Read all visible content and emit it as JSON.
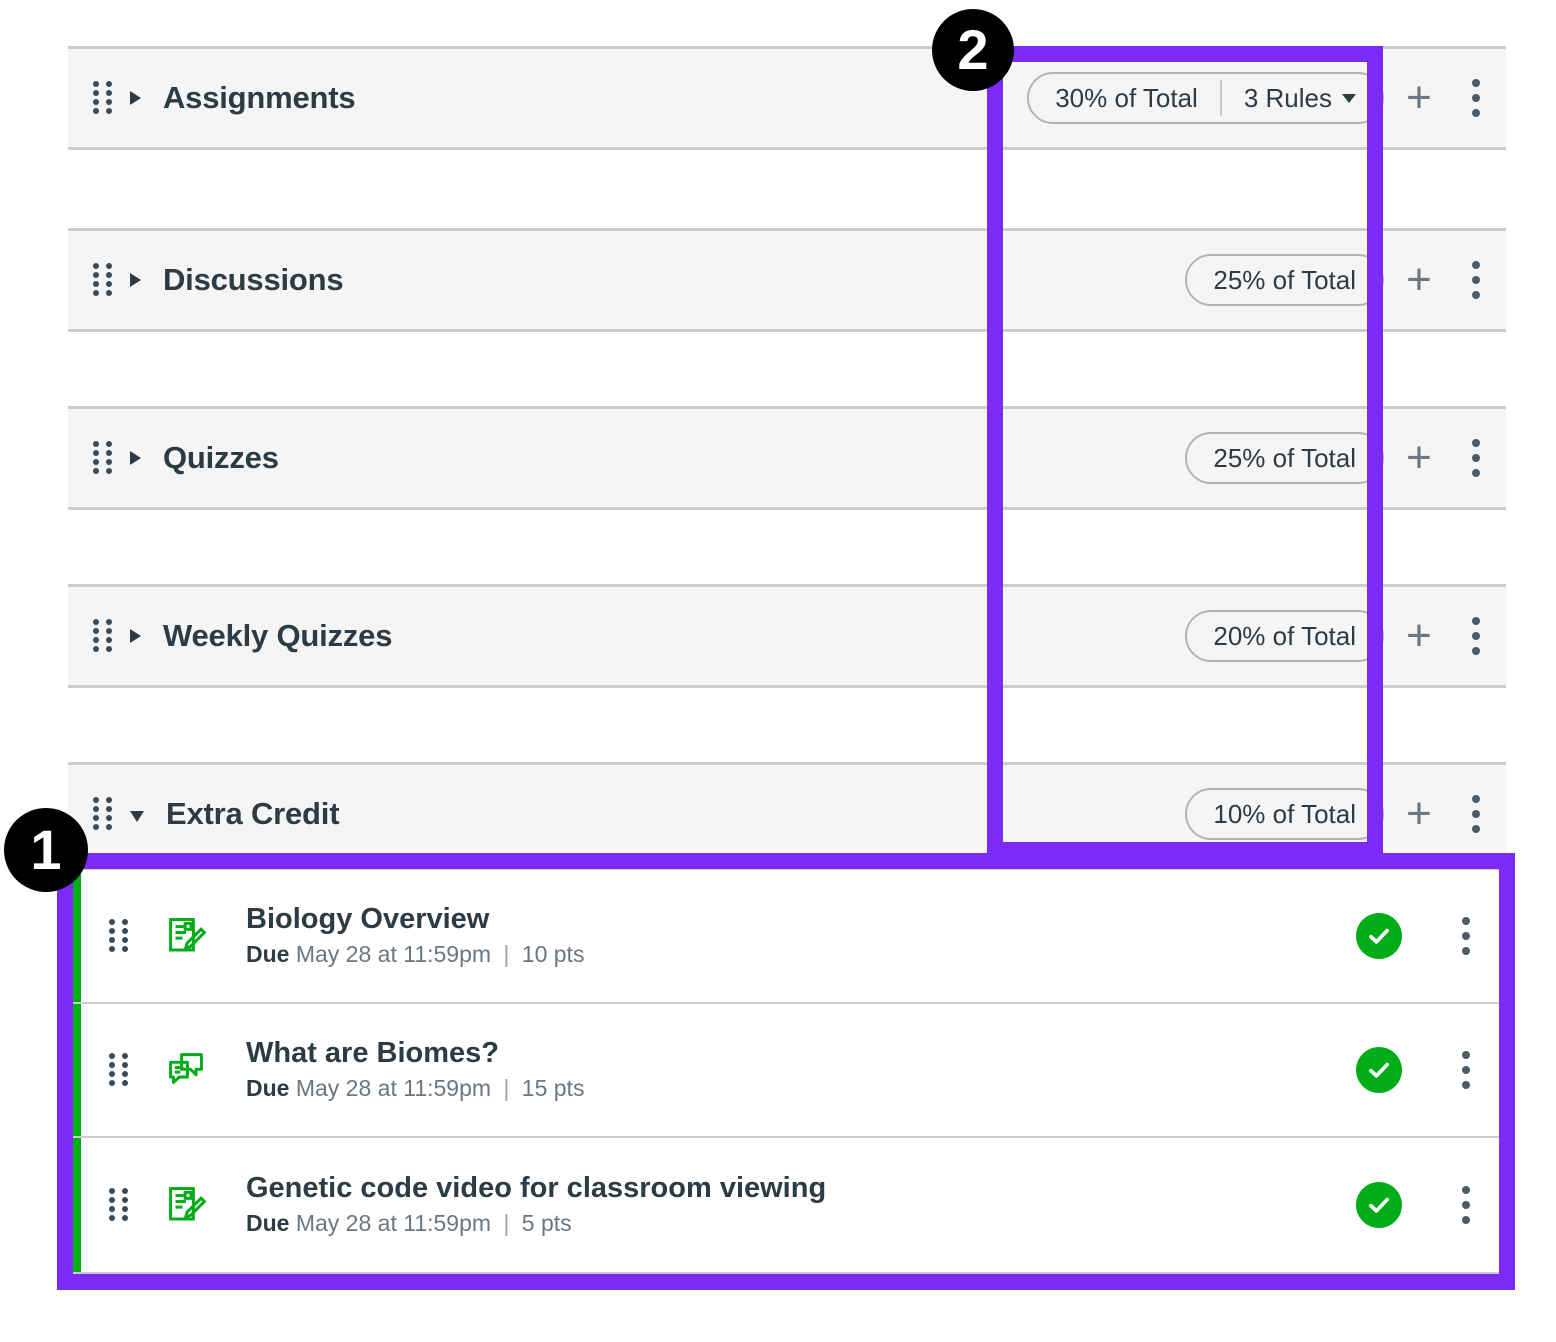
{
  "groups": [
    {
      "name": "Assignments",
      "expanded": false,
      "weight": "30% of Total",
      "rules": "3 Rules",
      "has_rules": true
    },
    {
      "name": "Discussions",
      "expanded": false,
      "weight": "25% of Total",
      "rules": "",
      "has_rules": false
    },
    {
      "name": "Quizzes",
      "expanded": false,
      "weight": "25% of Total",
      "rules": "",
      "has_rules": false
    },
    {
      "name": "Weekly Quizzes",
      "expanded": false,
      "weight": "20% of Total",
      "rules": "",
      "has_rules": false
    },
    {
      "name": "Extra Credit",
      "expanded": true,
      "weight": "10% of Total",
      "rules": "",
      "has_rules": false
    }
  ],
  "items": [
    {
      "title": "Biology Overview",
      "due_label": "Due",
      "due_date": "May 28 at 11:59pm",
      "separator": "|",
      "points": "10 pts",
      "icon": "assignment-icon",
      "status": "published"
    },
    {
      "title": "What are Biomes?",
      "due_label": "Due",
      "due_date": "May 28 at 11:59pm",
      "separator": "|",
      "points": "15 pts",
      "icon": "discussion-icon",
      "status": "published"
    },
    {
      "title": "Genetic code video for classroom viewing",
      "due_label": "Due",
      "due_date": "May 28 at 11:59pm",
      "separator": "|",
      "points": "5 pts",
      "icon": "assignment-icon",
      "status": "published"
    }
  ],
  "annotations": [
    {
      "label": "1"
    },
    {
      "label": "2"
    }
  ],
  "colors": {
    "annotation_purple": "#7C2BF7",
    "published_green": "#00AC18",
    "group_header_bg": "#F5F5F5",
    "border_gray": "#C7CDD1",
    "text_dark": "#2D3B45",
    "text_muted": "#6B7780"
  },
  "icons": {
    "drag_handle": "drag-handle-icon",
    "collapse_arrow": "triangle-right-icon",
    "expand_arrow": "triangle-down-icon",
    "add": "plus-icon",
    "more": "kebab-menu-icon",
    "published": "check-circle-icon"
  }
}
